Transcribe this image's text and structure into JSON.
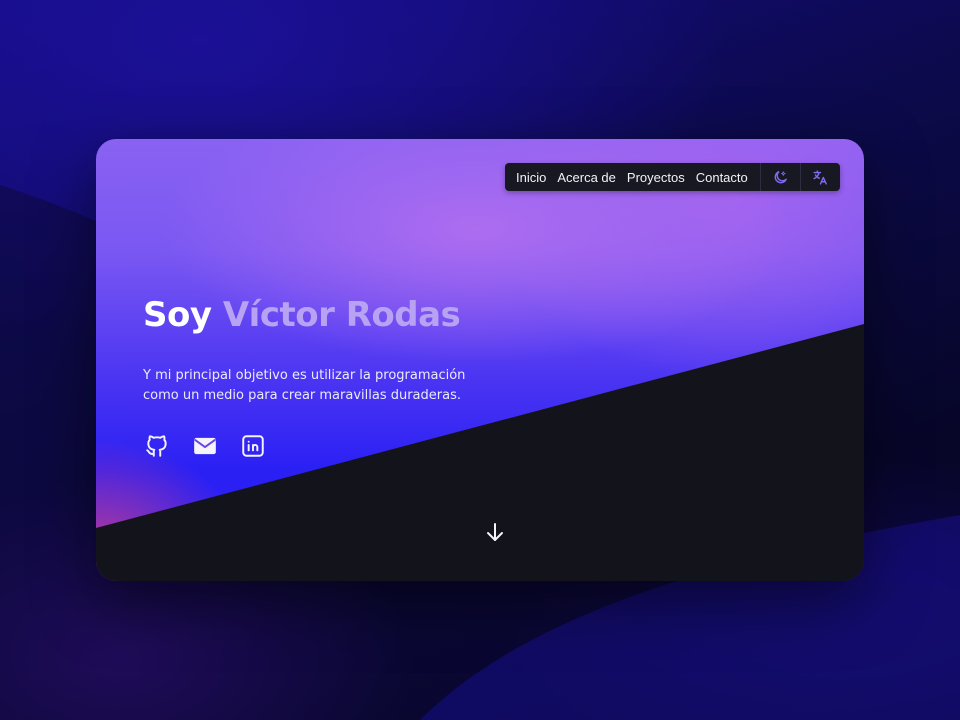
{
  "nav": {
    "links": [
      "Inicio",
      "Acerca de",
      "Proyectos",
      "Contacto"
    ],
    "theme_toggle_icon": "moon-icon",
    "language_toggle_icon": "translate-icon"
  },
  "hero": {
    "title_prefix": "Soy",
    "title_name": "Víctor Rodas",
    "description": "Y mi principal objetivo es utilizar la programación como un medio para crear maravillas duraderas."
  },
  "socials": [
    {
      "icon": "github-icon"
    },
    {
      "icon": "mail-icon"
    },
    {
      "icon": "linkedin-icon"
    }
  ],
  "scroll_icon": "arrow-down-icon",
  "colors": {
    "accent": "#b7a2f4",
    "nav_bg": "#181822",
    "dark_section": "#13131b",
    "icon_accent": "#7b6cf6"
  }
}
